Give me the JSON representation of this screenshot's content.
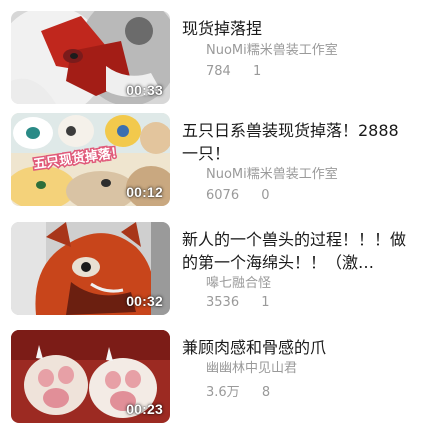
{
  "videos": [
    {
      "title": "现货掉落捏",
      "author": "NuoMi糯米兽装工作室",
      "views": "784",
      "comments": "1",
      "duration": "00:33",
      "thumbnail_palette": [
        "#f2f2f2",
        "#c0271d",
        "#8a8a8a"
      ]
    },
    {
      "title": "五只日系兽装现货掉落！2888一只！",
      "author": "NuoMi糯米兽装工作室",
      "views": "6076",
      "comments": "0",
      "duration": "00:12",
      "thumbnail_overlay_text": "五只现货掉落！",
      "thumbnail_palette": [
        "#e9dcc0",
        "#2a8a86",
        "#f2c94c"
      ]
    },
    {
      "title": "新人的一个兽头的过程！！！做的第一个海绵头！！（激…",
      "author": "嗥七融合怪",
      "views": "3536",
      "comments": "1",
      "duration": "00:32",
      "thumbnail_palette": [
        "#c8451b",
        "#6b1f10",
        "#d9d9d9"
      ]
    },
    {
      "title": "兼顾肉感和骨感的爪",
      "author": "幽幽林中见山君",
      "views": "3.6万",
      "comments": "8",
      "duration": "00:23",
      "thumbnail_palette": [
        "#9c2a22",
        "#efe3da",
        "#e7a0a6"
      ]
    }
  ]
}
